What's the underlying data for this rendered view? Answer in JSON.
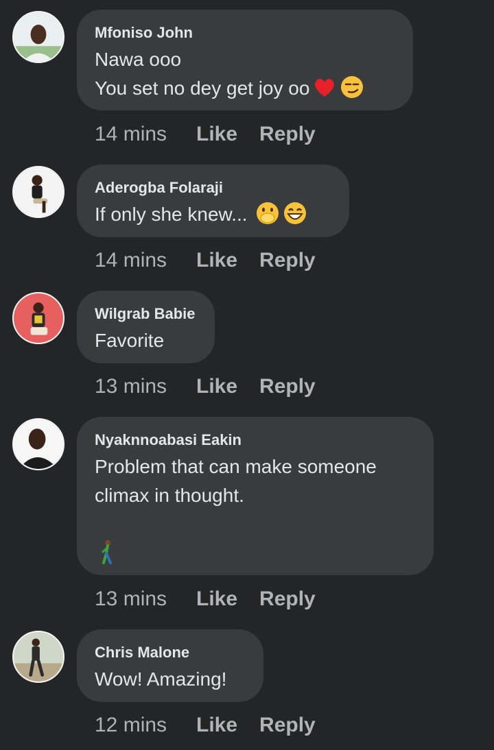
{
  "comments": [
    {
      "author": "Mfoniso John",
      "lines": [
        "Nawa ooo",
        "You set no dey get joy oo"
      ],
      "emojis": [
        "red-heart",
        "smirking-face"
      ],
      "time": "14 mins"
    },
    {
      "author": "Aderogba Folaraji",
      "lines": [
        "If only she knew..."
      ],
      "emojis": [
        "face-with-hand-over-mouth",
        "grinning-face"
      ],
      "time": "14 mins"
    },
    {
      "author": "Wilgrab Babie",
      "lines": [
        "Favorite"
      ],
      "emojis": [],
      "time": "13 mins"
    },
    {
      "author": "Nyaknnoabasi Eakin",
      "lines": [
        "Problem that can make someone",
        "climax in thought."
      ],
      "emojis": [
        "person-walking"
      ],
      "time": "13 mins"
    },
    {
      "author": "Chris Malone",
      "lines": [
        "Wow! Amazing!"
      ],
      "emojis": [],
      "time": "12 mins"
    }
  ],
  "actions": {
    "like": "Like",
    "reply": "Reply"
  },
  "colors": {
    "background": "#242526",
    "bubble": "#3a3b3c",
    "text": "#e4e6eb",
    "meta": "#b0b3b8"
  }
}
